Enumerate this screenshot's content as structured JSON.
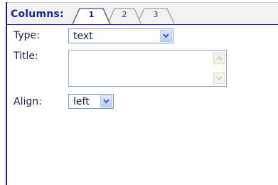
{
  "panel": {
    "title": "Columns:",
    "tabs": [
      {
        "label": "1",
        "active": true
      },
      {
        "label": "2",
        "active": false
      },
      {
        "label": "3",
        "active": false
      }
    ]
  },
  "form": {
    "type": {
      "label": "Type:",
      "value": "text"
    },
    "title": {
      "label": "Title:",
      "value": ""
    },
    "align": {
      "label": "Align:",
      "value": "left"
    }
  },
  "icons": {
    "dropdown": "chevron-down-icon",
    "scroll_up": "scroll-up-arrow-icon",
    "scroll_down": "scroll-down-arrow-icon"
  },
  "colors": {
    "accent": "#1a2a8a",
    "rule": "#2b1f66",
    "field_border": "#7f9db9"
  }
}
